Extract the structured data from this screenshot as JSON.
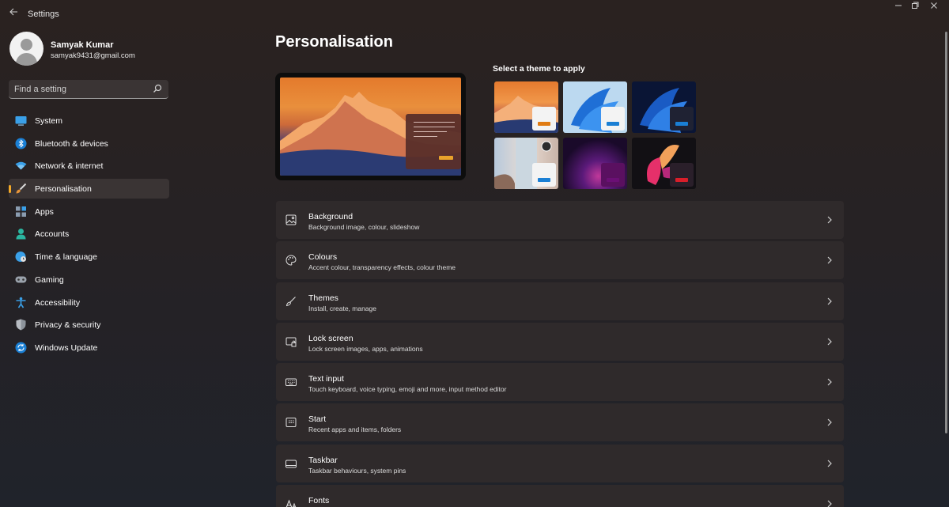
{
  "window": {
    "title": "Settings",
    "back_icon": "arrow-left-icon",
    "controls": [
      "minimize-icon",
      "restore-icon",
      "close-icon"
    ]
  },
  "profile": {
    "name": "Samyak Kumar",
    "email": "samyak9431@gmail.com"
  },
  "search": {
    "placeholder": "Find a setting",
    "value": ""
  },
  "sidebar": {
    "active_index": 3,
    "items": [
      {
        "label": "System",
        "icon": "monitor-icon"
      },
      {
        "label": "Bluetooth & devices",
        "icon": "bluetooth-icon"
      },
      {
        "label": "Network & internet",
        "icon": "wifi-icon"
      },
      {
        "label": "Personalisation",
        "icon": "paintbrush-icon"
      },
      {
        "label": "Apps",
        "icon": "apps-icon"
      },
      {
        "label": "Accounts",
        "icon": "person-icon"
      },
      {
        "label": "Time & language",
        "icon": "globe-clock-icon"
      },
      {
        "label": "Gaming",
        "icon": "gamepad-icon"
      },
      {
        "label": "Accessibility",
        "icon": "accessibility-icon"
      },
      {
        "label": "Privacy & security",
        "icon": "shield-icon"
      },
      {
        "label": "Windows Update",
        "icon": "update-icon"
      }
    ]
  },
  "main": {
    "title": "Personalisation",
    "theme_picker": {
      "label": "Select a theme to apply",
      "themes": [
        {
          "name": "mountain-sunset",
          "accent": "#e07b12"
        },
        {
          "name": "windows-light",
          "accent": "#1a7fd4"
        },
        {
          "name": "windows-dark",
          "accent": "#1a7fd4"
        },
        {
          "name": "captured-motion",
          "accent": "#1a7fd4"
        },
        {
          "name": "glow",
          "accent": "#6b0f75"
        },
        {
          "name": "flow",
          "accent": "#d91e2a"
        }
      ]
    },
    "settings": [
      {
        "title": "Background",
        "desc": "Background image, colour, slideshow",
        "icon": "image-icon"
      },
      {
        "title": "Colours",
        "desc": "Accent colour, transparency effects, colour theme",
        "icon": "palette-icon"
      },
      {
        "title": "Themes",
        "desc": "Install, create, manage",
        "icon": "brush-icon"
      },
      {
        "title": "Lock screen",
        "desc": "Lock screen images, apps, animations",
        "icon": "lock-screen-icon"
      },
      {
        "title": "Text input",
        "desc": "Touch keyboard, voice typing, emoji and more, input method editor",
        "icon": "keyboard-icon"
      },
      {
        "title": "Start",
        "desc": "Recent apps and items, folders",
        "icon": "start-icon"
      },
      {
        "title": "Taskbar",
        "desc": "Taskbar behaviours, system pins",
        "icon": "taskbar-icon"
      },
      {
        "title": "Fonts",
        "desc": "",
        "icon": "fonts-icon"
      }
    ]
  },
  "colors": {
    "accent": "#f4a928",
    "background": "#262224",
    "card": "#2f2a2b"
  }
}
